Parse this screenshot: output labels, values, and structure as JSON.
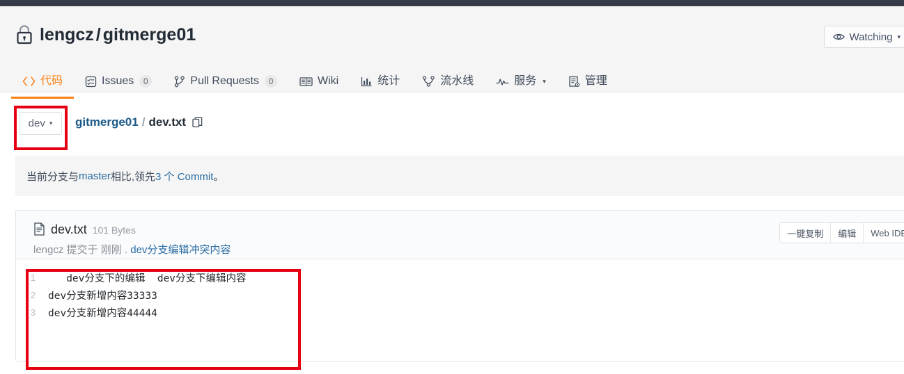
{
  "topbar": {
    "present": true,
    "color": "#353b49"
  },
  "header": {
    "lock_icon": "lock-icon",
    "owner": "lengcz",
    "separator": "/",
    "repo": "gitmerge01",
    "watch_button": {
      "icon": "eye-icon",
      "label": "Watching",
      "caret": "▾"
    }
  },
  "tabs": [
    {
      "icon": "code-icon",
      "label": "代码",
      "count": null,
      "active": true,
      "caret": false
    },
    {
      "icon": "issues-icon",
      "label": "Issues",
      "count": "0",
      "active": false,
      "caret": false
    },
    {
      "icon": "pr-icon",
      "label": "Pull Requests",
      "count": "0",
      "active": false,
      "caret": false
    },
    {
      "icon": "wiki-icon",
      "label": "Wiki",
      "count": null,
      "active": false,
      "caret": false
    },
    {
      "icon": "stats-icon",
      "label": "统计",
      "count": null,
      "active": false,
      "caret": false
    },
    {
      "icon": "pipeline-icon",
      "label": "流水线",
      "count": null,
      "active": false,
      "caret": false
    },
    {
      "icon": "service-icon",
      "label": "服务",
      "count": null,
      "active": false,
      "caret": true
    },
    {
      "icon": "manage-icon",
      "label": "管理",
      "count": null,
      "active": false,
      "caret": false
    }
  ],
  "branch": {
    "current": "dev",
    "caret": "▾"
  },
  "breadcrumb": {
    "repo_link": "gitmerge01",
    "separator": "/",
    "current_file": "dev.txt",
    "copy_icon": "copy-icon"
  },
  "notice": {
    "prefix": "当前分支与 ",
    "base_branch": "master",
    "middle": " 相比,领先 ",
    "commit_link": "3 个 Commit",
    "suffix": "。"
  },
  "file": {
    "doc_icon": "file-text-icon",
    "name": "dev.txt",
    "size": "101 Bytes",
    "commit_author": "lengcz",
    "commit_prefix": " 提交于 ",
    "commit_time": "刚刚",
    "commit_dot": " . ",
    "commit_message": "dev分支编辑冲突内容",
    "actions": [
      {
        "label": "一键复制"
      },
      {
        "label": "编辑"
      },
      {
        "label": "Web IDE"
      }
    ],
    "lines": [
      {
        "no": "1",
        "text": "   dev分支下的编辑  dev分支下编辑内容"
      },
      {
        "no": "2",
        "text": "dev分支新增内容33333"
      },
      {
        "no": "3",
        "text": "dev分支新增内容44444"
      }
    ]
  },
  "annotations": [
    {
      "name": "branch-selector-highlight",
      "color": "#e60012"
    },
    {
      "name": "file-content-highlight",
      "color": "#e60012"
    }
  ],
  "colors": {
    "accent_orange": "#f98218",
    "link_blue": "#2b6ca3",
    "annotation_red": "#e60012",
    "topbar_dark": "#353b49",
    "panel_gray": "#f5f5f5"
  }
}
